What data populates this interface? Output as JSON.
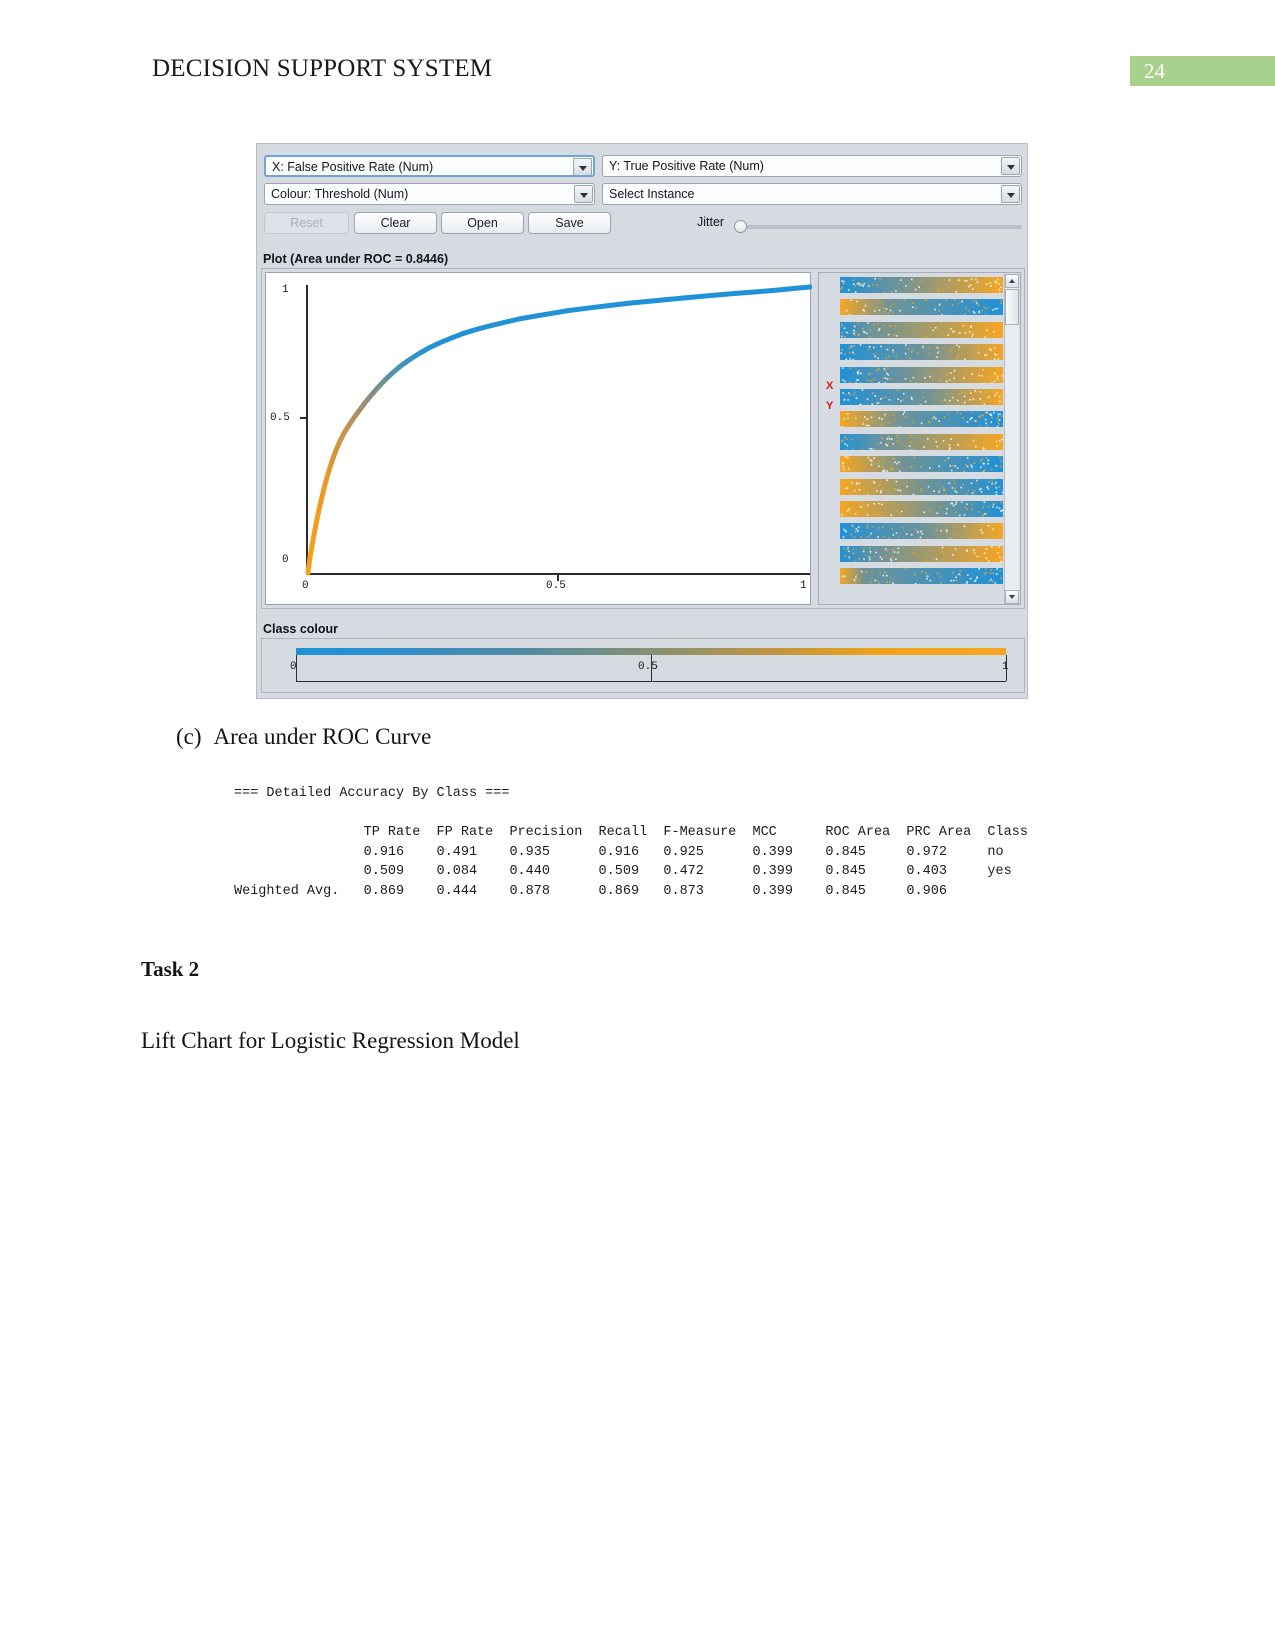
{
  "document": {
    "header_title": "DECISION SUPPORT SYSTEM",
    "page_number": "24",
    "header_accent_color": "#a9d18e",
    "figure_caption_index": "(c)",
    "figure_caption_text": "Area under ROC Curve",
    "task_heading": "Task 2",
    "task_body": "Lift Chart for Logistic Regression Model"
  },
  "weka": {
    "x_axis_combo": "X: False Positive Rate (Num)",
    "y_axis_combo": "Y: True Positive Rate (Num)",
    "colour_combo": "Colour: Threshold (Num)",
    "instance_combo": "Select Instance",
    "buttons": [
      {
        "label": "Reset",
        "enabled": false
      },
      {
        "label": "Clear",
        "enabled": true
      },
      {
        "label": "Open",
        "enabled": true
      },
      {
        "label": "Save",
        "enabled": true
      }
    ],
    "jitter_label": "Jitter",
    "jitter_value": 0,
    "plot_caption": "Plot (Area under ROC = 0.8446)",
    "class_colour_label": "Class colour",
    "class_colour_ticks": [
      "0",
      "0.5",
      "1"
    ],
    "axis_marker_x": "X",
    "axis_marker_y": "Y",
    "colors": {
      "low": "#1f92d8",
      "high": "#f5a623",
      "panel": "#d6dbe2",
      "marker": "#d31a1a"
    }
  },
  "chart_data": {
    "type": "line",
    "title": "Plot (Area under ROC = 0.8446)",
    "xlabel": "False Positive Rate",
    "ylabel": "True Positive Rate",
    "xlim": [
      0,
      1
    ],
    "ylim": [
      0,
      1
    ],
    "xticks": [
      "0",
      "0.5",
      "1"
    ],
    "yticks": [
      "0",
      "0.5",
      "1"
    ],
    "grid": false,
    "legend": "none",
    "area_under_curve": 0.8446,
    "colormap": {
      "start": "#f5a623",
      "end": "#1f92d8",
      "meaning": "Threshold (Num)"
    },
    "series": [
      {
        "name": "ROC curve",
        "x": [
          0.0,
          0.004,
          0.01,
          0.016,
          0.022,
          0.028,
          0.034,
          0.04,
          0.048,
          0.056,
          0.064,
          0.072,
          0.082,
          0.092,
          0.102,
          0.114,
          0.126,
          0.14,
          0.154,
          0.17,
          0.186,
          0.204,
          0.222,
          0.242,
          0.264,
          0.286,
          0.31,
          0.336,
          0.362,
          0.39,
          0.42,
          0.452,
          0.486,
          0.52,
          0.556,
          0.594,
          0.632,
          0.672,
          0.714,
          0.756,
          0.8,
          0.846,
          0.892,
          0.94,
          0.97,
          1.0
        ],
        "y": [
          0.0,
          0.055,
          0.115,
          0.17,
          0.222,
          0.268,
          0.31,
          0.348,
          0.392,
          0.43,
          0.462,
          0.49,
          0.518,
          0.544,
          0.568,
          0.596,
          0.622,
          0.65,
          0.676,
          0.702,
          0.726,
          0.748,
          0.768,
          0.788,
          0.806,
          0.822,
          0.838,
          0.852,
          0.864,
          0.876,
          0.888,
          0.898,
          0.908,
          0.918,
          0.926,
          0.934,
          0.942,
          0.949,
          0.956,
          0.963,
          0.97,
          0.977,
          0.983,
          0.99,
          0.995,
          1.0
        ]
      }
    ]
  },
  "accuracy": {
    "section_title": "=== Detailed Accuracy By Class ===",
    "columns": [
      "TP Rate",
      "FP Rate",
      "Precision",
      "Recall",
      "F-Measure",
      "MCC",
      "ROC Area",
      "PRC Area",
      "Class"
    ],
    "rows": [
      {
        "label": "",
        "values": [
          "0.916",
          "0.491",
          "0.935",
          "0.916",
          "0.925",
          "0.399",
          "0.845",
          "0.972"
        ],
        "class": "no"
      },
      {
        "label": "",
        "values": [
          "0.509",
          "0.084",
          "0.440",
          "0.509",
          "0.472",
          "0.399",
          "0.845",
          "0.403"
        ],
        "class": "yes"
      },
      {
        "label": "Weighted Avg.",
        "values": [
          "0.869",
          "0.444",
          "0.878",
          "0.869",
          "0.873",
          "0.399",
          "0.845",
          "0.906"
        ],
        "class": ""
      }
    ],
    "rendered_text": "=== Detailed Accuracy By Class ===\n\n                TP Rate  FP Rate  Precision  Recall  F-Measure  MCC      ROC Area  PRC Area  Class\n                0.916    0.491    0.935      0.916   0.925      0.399    0.845     0.972     no\n                0.509    0.084    0.440      0.509   0.472      0.399    0.845     0.403     yes\nWeighted Avg.   0.869    0.444    0.878      0.869   0.873      0.399    0.845     0.906"
  }
}
